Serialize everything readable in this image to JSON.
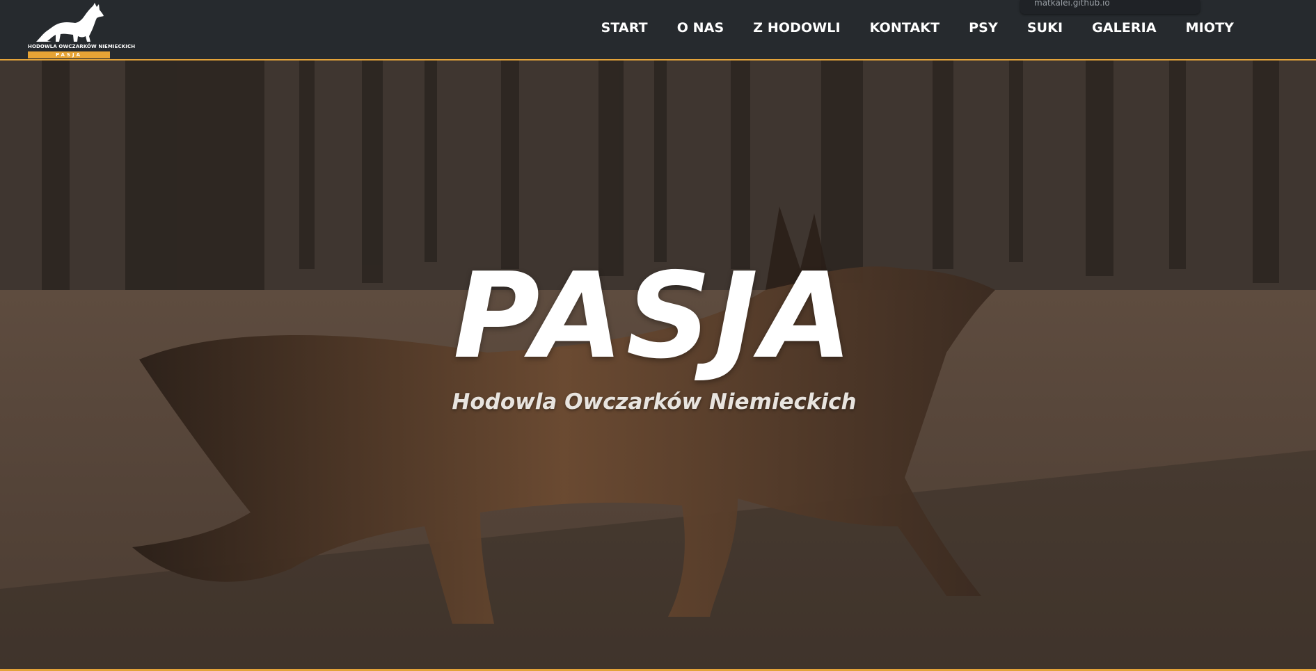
{
  "brand": {
    "logo_text": "HODOWLA OWCZARKÓW NIEMIECKICH",
    "logo_sub": "PASJA",
    "accent": "#e3a33a",
    "nav_bg": "#262a2e"
  },
  "nav": {
    "items": [
      {
        "label": "START"
      },
      {
        "label": "O NAS"
      },
      {
        "label": "Z HODOWLI"
      },
      {
        "label": "KONTAKT"
      },
      {
        "label": "PSY"
      },
      {
        "label": "SUKI"
      },
      {
        "label": "GALERIA"
      },
      {
        "label": "MIOTY"
      }
    ]
  },
  "tooltip": {
    "text": "matkalei.github.io"
  },
  "hero": {
    "title": "PASJA",
    "subtitle": "Hodowla Owczarków Niemieckich",
    "image": "german-shepherd-running-in-forest"
  }
}
